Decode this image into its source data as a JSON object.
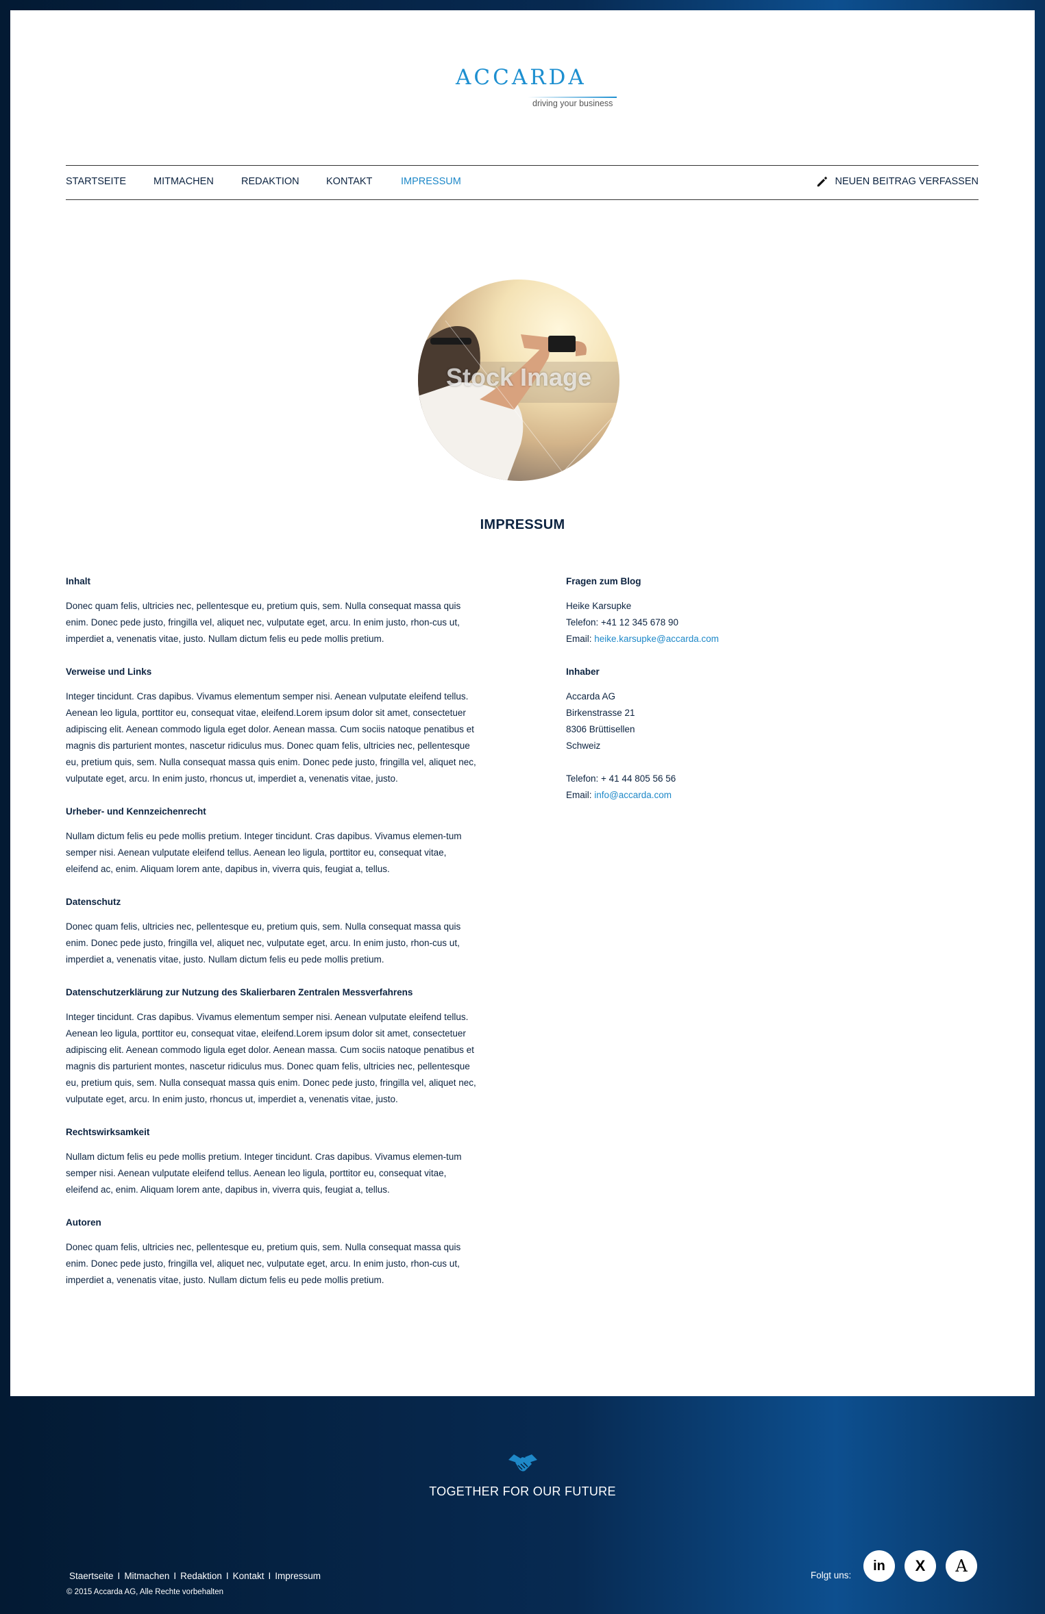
{
  "brand": {
    "name": "ACCARDA",
    "tagline": "driving your business",
    "accent": "#1e88c8"
  },
  "nav": {
    "items": [
      {
        "label": "STARTSEITE"
      },
      {
        "label": "MITMACHEN"
      },
      {
        "label": "REDAKTION"
      },
      {
        "label": "KONTAKT"
      },
      {
        "label": "IMPRESSUM",
        "active": true
      }
    ],
    "new_post_label": "NEUEN BEITRAG VERFASSEN"
  },
  "hero": {
    "watermark": "Stock Image"
  },
  "page_title": "IMPRESSUM",
  "sections": [
    {
      "heading": "Inhalt",
      "text": "Donec quam felis, ultricies nec, pellentesque eu, pretium quis, sem. Nulla consequat massa quis enim. Donec pede justo, fringilla vel, aliquet nec, vulputate eget, arcu. In enim justo, rhon-cus ut, imperdiet a, venenatis vitae, justo. Nullam dictum felis eu pede mollis pretium."
    },
    {
      "heading": "Verweise und Links",
      "text": "Integer tincidunt. Cras dapibus. Vivamus elementum semper nisi. Aenean vulputate eleifend tellus. Aenean leo ligula, porttitor eu, consequat vitae, eleifend.Lorem ipsum dolor sit amet, consectetuer adipiscing elit. Aenean commodo ligula eget dolor. Aenean massa. Cum sociis natoque penatibus et magnis dis parturient montes, nascetur ridiculus mus. Donec quam felis, ultricies nec, pellentesque eu, pretium quis, sem. Nulla consequat massa quis enim. Donec pede justo, fringilla vel, aliquet nec, vulputate eget, arcu. In enim justo, rhoncus ut, imperdiet a, venenatis vitae, justo."
    },
    {
      "heading": "Urheber- und Kennzeichenrecht",
      "text": "Nullam dictum felis eu pede mollis pretium. Integer tincidunt. Cras dapibus. Vivamus elemen-tum semper nisi. Aenean vulputate eleifend tellus. Aenean leo ligula, porttitor eu, consequat vitae, eleifend ac, enim. Aliquam lorem ante, dapibus in, viverra quis, feugiat a, tellus."
    },
    {
      "heading": "Datenschutz",
      "text": "Donec quam felis, ultricies nec, pellentesque eu, pretium quis, sem. Nulla consequat massa quis enim. Donec pede justo, fringilla vel, aliquet nec, vulputate eget, arcu. In enim justo, rhon-cus ut, imperdiet a, venenatis vitae, justo. Nullam dictum felis eu pede mollis pretium."
    },
    {
      "heading": "Datenschutzerklärung zur Nutzung des Skalierbaren Zentralen Messverfahrens",
      "text": "Integer tincidunt. Cras dapibus. Vivamus elementum semper nisi. Aenean vulputate eleifend tellus. Aenean leo ligula, porttitor eu, consequat vitae, eleifend.Lorem ipsum dolor sit amet, consectetuer adipiscing elit. Aenean commodo ligula eget dolor. Aenean massa. Cum sociis natoque penatibus et magnis dis parturient montes, nascetur ridiculus mus. Donec quam felis, ultricies nec, pellentesque eu, pretium quis, sem. Nulla consequat massa quis enim. Donec pede justo, fringilla vel, aliquet nec, vulputate eget, arcu. In enim justo, rhoncus ut, imperdiet a, venenatis vitae, justo."
    },
    {
      "heading": "Rechtswirksamkeit",
      "text": "Nullam dictum felis eu pede mollis pretium. Integer tincidunt. Cras dapibus. Vivamus elemen-tum semper nisi. Aenean vulputate eleifend tellus. Aenean leo ligula, porttitor eu, consequat vitae, eleifend ac, enim. Aliquam lorem ante, dapibus in, viverra quis, feugiat a, tellus."
    },
    {
      "heading": "Autoren",
      "text": "Donec quam felis, ultricies nec, pellentesque eu, pretium quis, sem. Nulla consequat massa quis enim. Donec pede justo, fringilla vel, aliquet nec, vulputate eget, arcu. In enim justo, rhon-cus ut, imperdiet a, venenatis vitae, justo. Nullam dictum felis eu pede mollis pretium."
    }
  ],
  "blog_contact": {
    "heading": "Fragen zum Blog",
    "name": "Heike Karsupke",
    "phone": "Telefon: +41 12 345 678 90",
    "email_label": "Email: ",
    "email": "heike.karsupke@accarda.com"
  },
  "owner": {
    "heading": "Inhaber",
    "company": "Accarda AG",
    "street": "Birkenstrasse 21",
    "city": "8306 Brüttisellen",
    "country": "Schweiz",
    "phone": "Telefon: + 41 44 805 56 56",
    "email_label": "Email: ",
    "email": "info@accarda.com"
  },
  "footer": {
    "slogan": "TOGETHER FOR OUR FUTURE",
    "links": [
      "Staertseite",
      "Mitmachen",
      "Redaktion",
      "Kontakt",
      "Impressum"
    ],
    "separator": "I",
    "copyright": "© 2015 Accarda AG, Alle Rechte vorbehalten",
    "follow_label": "Folgt uns:",
    "social": [
      {
        "icon": "linkedin-icon",
        "glyph": "in"
      },
      {
        "icon": "xing-icon",
        "glyph": "X"
      },
      {
        "icon": "accarda-icon",
        "glyph": "A"
      }
    ]
  }
}
